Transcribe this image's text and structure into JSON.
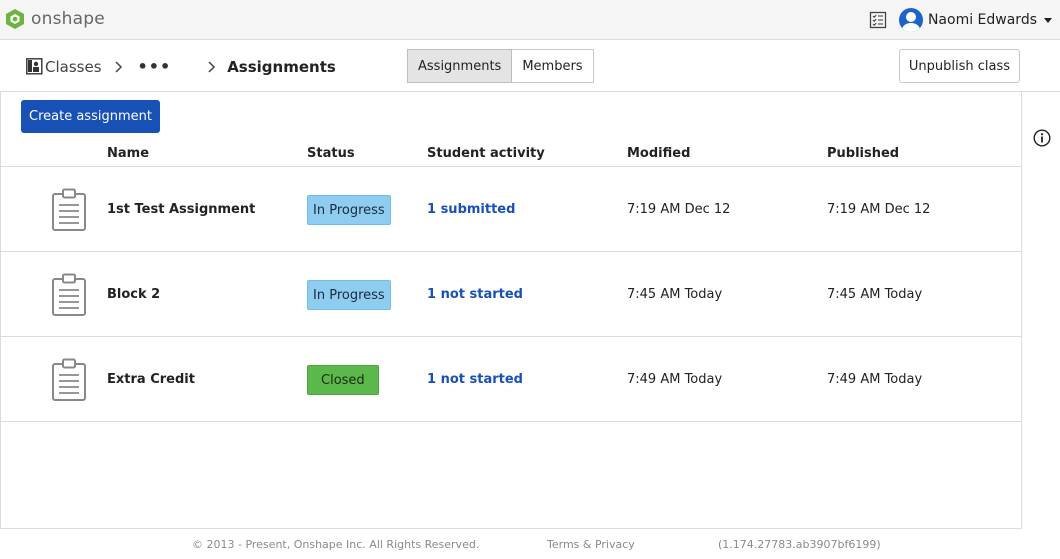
{
  "app": {
    "logo_text": "onshape",
    "user_name": "Naomi Edwards"
  },
  "breadcrumb": {
    "classes": "Classes",
    "more": "•••",
    "current": "Assignments"
  },
  "tabs": [
    {
      "label": "Assignments",
      "active": true
    },
    {
      "label": "Members",
      "active": false
    }
  ],
  "actions": {
    "unpublish": "Unpublish class",
    "create": "Create assignment"
  },
  "table": {
    "columns": [
      "Name",
      "Status",
      "Student activity",
      "Modified",
      "Published"
    ],
    "rows": [
      {
        "name": "1st Test Assignment",
        "status": "In Progress",
        "activity": "1 submitted",
        "modified": "7:19 AM Dec 12",
        "published": "7:19 AM Dec 12"
      },
      {
        "name": "Block 2",
        "status": "In Progress",
        "activity": "1 not started",
        "modified": "7:45 AM Today",
        "published": "7:45 AM Today"
      },
      {
        "name": "Extra Credit",
        "status": "Closed",
        "activity": "1 not started",
        "modified": "7:49 AM Today",
        "published": "7:49 AM Today"
      }
    ]
  },
  "footer": {
    "copyright": "© 2013 - Present, Onshape Inc. All Rights Reserved.",
    "terms": "Terms & Privacy",
    "version": "(1.174.27783.ab3907bf6199)"
  },
  "colors": {
    "primary": "#1851b5",
    "in_progress": "#8ecdf0",
    "closed": "#5bb84a",
    "logo_green": "#6cb33f"
  }
}
